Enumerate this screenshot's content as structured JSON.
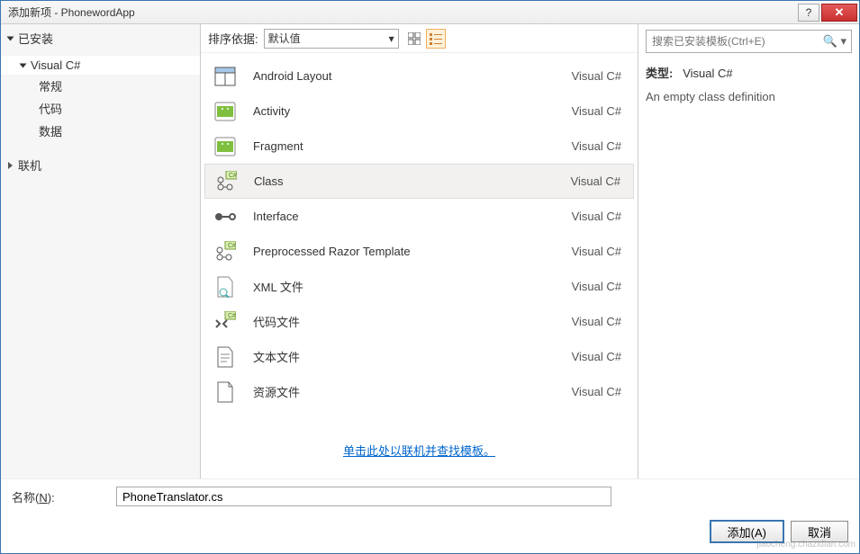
{
  "title": "添加新项 - PhonewordApp",
  "sidebar": {
    "installed": "已安装",
    "csharp": "Visual C#",
    "children": [
      "常规",
      "代码",
      "数据"
    ],
    "online": "联机"
  },
  "toolbar": {
    "sort_label": "排序依据:",
    "sort_value": "默认值"
  },
  "search": {
    "placeholder": "搜索已安装模板(Ctrl+E)"
  },
  "templates": [
    {
      "name": "Android Layout",
      "lang": "Visual C#",
      "icon": "layout"
    },
    {
      "name": "Activity",
      "lang": "Visual C#",
      "icon": "android"
    },
    {
      "name": "Fragment",
      "lang": "Visual C#",
      "icon": "android"
    },
    {
      "name": "Class",
      "lang": "Visual C#",
      "icon": "class",
      "selected": true
    },
    {
      "name": "Interface",
      "lang": "Visual C#",
      "icon": "interface"
    },
    {
      "name": "Preprocessed Razor Template",
      "lang": "Visual C#",
      "icon": "razor"
    },
    {
      "name": "XML 文件",
      "lang": "Visual C#",
      "icon": "xml"
    },
    {
      "name": "代码文件",
      "lang": "Visual C#",
      "icon": "code"
    },
    {
      "name": "文本文件",
      "lang": "Visual C#",
      "icon": "text"
    },
    {
      "name": "资源文件",
      "lang": "Visual C#",
      "icon": "resource"
    }
  ],
  "online_link": "单击此处以联机并查找模板。",
  "detail": {
    "type_label": "类型:",
    "type_value": "Visual C#",
    "desc": "An empty class definition"
  },
  "name_field": {
    "label": "名称(N):",
    "value": "PhoneTranslator.cs"
  },
  "buttons": {
    "add": "添加(A)",
    "cancel": "取消"
  },
  "watermark": "jiaocheng.chazidian.com"
}
